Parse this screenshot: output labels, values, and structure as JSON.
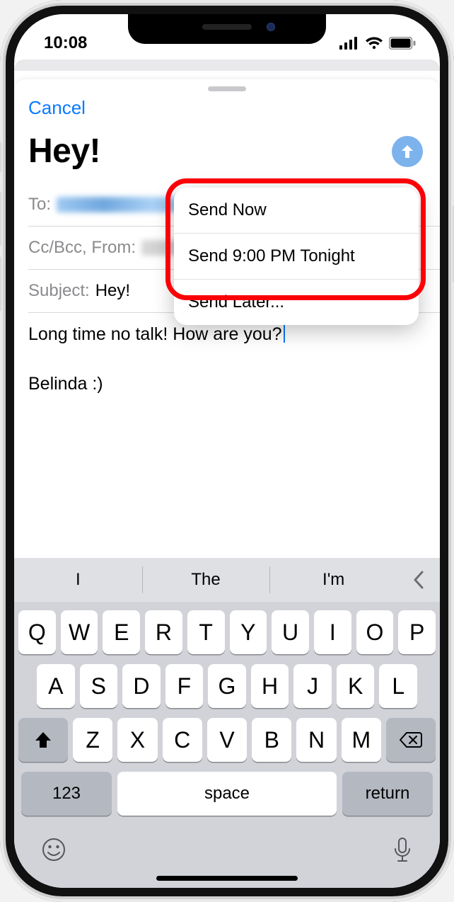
{
  "status": {
    "time": "10:08"
  },
  "nav": {
    "cancel": "Cancel"
  },
  "compose": {
    "title": "Hey!",
    "fields": {
      "to_label": "To:",
      "ccbcc_label": "Cc/Bcc, From:",
      "subject_label": "Subject:",
      "subject_value": "Hey!"
    },
    "body_line1": "Long time no talk! How are you?",
    "signature": "Belinda :)"
  },
  "send_menu": {
    "items": [
      "Send Now",
      "Send 9:00 PM Tonight",
      "Send Later..."
    ]
  },
  "keyboard": {
    "predictions": [
      "I",
      "The",
      "I'm"
    ],
    "row1": [
      "Q",
      "W",
      "E",
      "R",
      "T",
      "Y",
      "U",
      "I",
      "O",
      "P"
    ],
    "row2": [
      "A",
      "S",
      "D",
      "F",
      "G",
      "H",
      "J",
      "K",
      "L"
    ],
    "row3": [
      "Z",
      "X",
      "C",
      "V",
      "B",
      "N",
      "M"
    ],
    "numkey": "123",
    "space": "space",
    "return": "return"
  }
}
